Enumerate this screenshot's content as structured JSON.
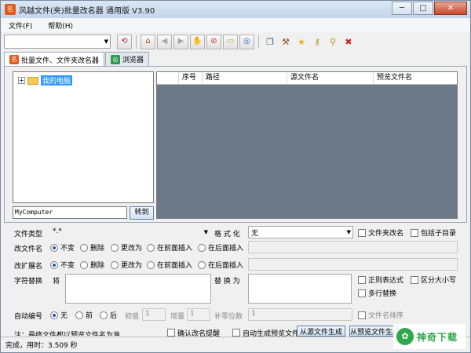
{
  "window": {
    "title": "风越文件(夹)批量改名器 通用版 V3.90",
    "minimize": "─",
    "maximize": "□",
    "close": "✕"
  },
  "menu": [
    {
      "label": "文件(F)"
    },
    {
      "label": "帮助(H)"
    }
  ],
  "tabs": [
    {
      "label": "批量文件、文件夹改名器"
    },
    {
      "label": "浏览器"
    }
  ],
  "tree": {
    "root_label": "我的电脑",
    "expander": "+"
  },
  "path_input": {
    "value": "MyComputer"
  },
  "goto_button": "转到",
  "grid": {
    "columns": [
      "序号",
      "路径",
      "源文件名",
      "预览文件名"
    ]
  },
  "form": {
    "file_type_label": "文件类型",
    "file_type_value": "*.*",
    "format_label": "格 式 化",
    "format_value": "无",
    "folder_rename": "文件夹改名",
    "include_subdirs": "包括子目录",
    "rename_file_label": "改文件名",
    "rename_ext_label": "改扩展名",
    "radio_options": [
      "不变",
      "删除",
      "更改为",
      "在前面插入",
      "在后面插入"
    ],
    "replace_label": "字符替换",
    "replace_from": "将",
    "replace_to": "替 换 为",
    "regex": "正则表达式",
    "case_sensitive": "区分大小写",
    "multiline_replace": "多行替换",
    "auto_number_label": "自动编号",
    "number_options": [
      "无",
      "前",
      "后"
    ],
    "initial_label": "初值",
    "initial_value": "1",
    "increment_label": "增量",
    "increment_value": "1",
    "pad_label": "补零位数",
    "pad_value": "1",
    "file_order": "文件名排序",
    "note": "注：最终文件都以预览文件名为准",
    "confirm_check": "确认改名提醒",
    "auto_refresh": "自动生成预览文件名",
    "gen_button": "从源文件生成",
    "gen_preview_button": "从预览文件生成"
  },
  "status": {
    "text": "完成，用时：3.509 秒"
  },
  "watermark": {
    "text": "神奇下载"
  }
}
